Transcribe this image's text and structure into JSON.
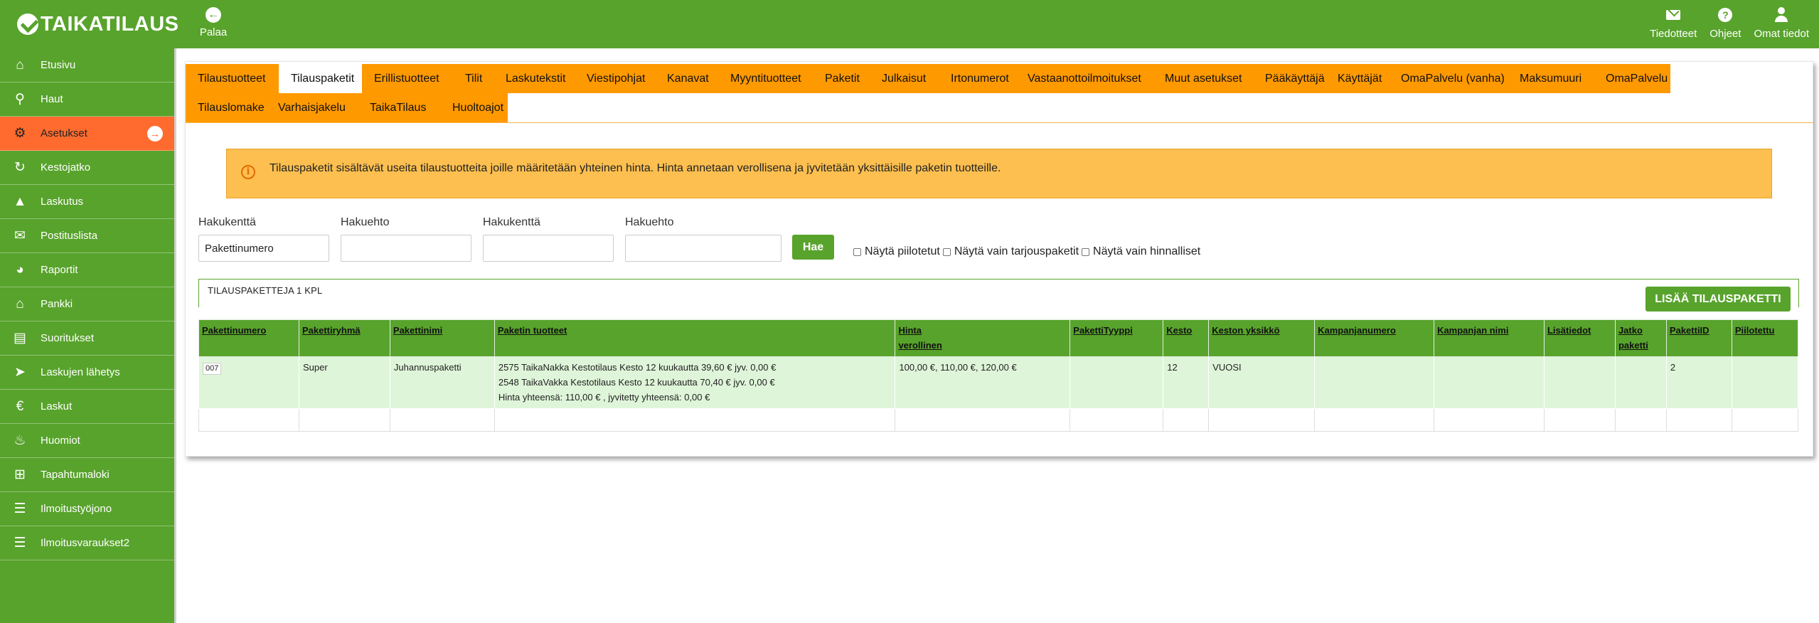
{
  "app": {
    "logo_text": "TAIKATILAUS",
    "back_label": "Palaa"
  },
  "header_actions": [
    {
      "label": "Tiedotteet",
      "icon": "envelope-icon"
    },
    {
      "label": "Ohjeet",
      "icon": "help-icon"
    },
    {
      "label": "Omat tiedot",
      "icon": "user-icon"
    }
  ],
  "sidebar": {
    "items": [
      {
        "label": "Etusivu",
        "icon": "home-icon"
      },
      {
        "label": "Haut",
        "icon": "search-icon"
      },
      {
        "label": "Asetukset",
        "icon": "gear-icon",
        "active": true
      },
      {
        "label": "Kestojatko",
        "icon": "refresh-icon"
      },
      {
        "label": "Laskutus",
        "icon": "thumbs-up-icon"
      },
      {
        "label": "Postituslista",
        "icon": "envelope-icon"
      },
      {
        "label": "Raportit",
        "icon": "pie-chart-icon"
      },
      {
        "label": "Pankki",
        "icon": "bank-icon"
      },
      {
        "label": "Suoritukset",
        "icon": "receipt-icon"
      },
      {
        "label": "Laskujen lähetys",
        "icon": "send-icon"
      },
      {
        "label": "Laskut",
        "icon": "euro-icon"
      },
      {
        "label": "Huomiot",
        "icon": "bell-icon"
      },
      {
        "label": "Tapahtumaloki",
        "icon": "grid-icon"
      },
      {
        "label": "Ilmoitustyöjono",
        "icon": "list-icon"
      },
      {
        "label": "Ilmoitusvaraukset2",
        "icon": "list-indent-icon"
      }
    ]
  },
  "tabs": {
    "row1": [
      "Tilaustuotteet",
      "Tilauspaketit",
      "Erillistuotteet",
      "Tilit",
      "Laskutekstit",
      "Viestipohjat",
      "Kanavat",
      "Myyntituotteet",
      "Paketit",
      "Julkaisut",
      "Irtonumerot",
      "Vastaanottoilmoitukset",
      "Muut asetukset",
      "Pääkäyttäjä",
      "Käyttäjät",
      "OmaPalvelu (vanha)",
      "Maksumuuri",
      "OmaPalvelu"
    ],
    "row2": [
      "Tilauslomake",
      "Varhaisjakelu",
      "TaikaTilaus",
      "Huoltoajot"
    ],
    "active": "Tilauspaketit"
  },
  "info_message": "Tilauspaketit sisältävät useita tilaustuotteita joille määritetään yhteinen hinta. Hinta annetaan verollisena ja jyvitetään yksittäisille paketin tuotteille.",
  "search": {
    "fields": [
      {
        "label": "Hakukenttä",
        "value": "Pakettinumero"
      },
      {
        "label": "Hakuehto",
        "value": ""
      },
      {
        "label": "Hakukenttä",
        "value": ""
      },
      {
        "label": "Hakuehto",
        "value": ""
      }
    ],
    "button_label": "Hae",
    "checkboxes": [
      "Näytä piilotetut",
      "Näytä vain tarjouspaketit",
      "Näytä vain hinnalliset"
    ]
  },
  "results": {
    "count_label": "TILAUSPAKETTEJA 1 KPL",
    "add_button_label": "LISÄÄ TILAUSPAKETTI",
    "columns": [
      "Pakettinumero",
      "Pakettiryhmä",
      "Pakettinimi",
      "Paketin tuotteet",
      "Hinta verollinen",
      "PakettiTyyppi",
      "Kesto",
      "Keston yksikkö",
      "Kampanjanumero",
      "Kampanjan nimi",
      "Lisätiedot",
      "Jatko paketti",
      "PakettiID",
      "Piilotettu"
    ],
    "rows": [
      {
        "pakettinumero": "007",
        "pakettiryhma": "Super",
        "pakettinimi": "Juhannuspaketti",
        "tuotteet": [
          "2575 TaikaNakka Kestotilaus Kesto 12 kuukautta 39,60 € jyv. 0,00 €",
          "2548 TaikaVakka Kestotilaus Kesto 12 kuukautta 70,40 € jyv. 0,00 €",
          "Hinta yhteensä: 110,00 € , jyvitetty yhteensä: 0,00 €"
        ],
        "hinta": "100,00 €, 110,00 €, 120,00 €",
        "pakettityyppi": "",
        "kesto": "12",
        "keston_yksikko": "VUOSI",
        "kampanjanumero": "",
        "kampanjan_nimi": "",
        "lisatiedot": "",
        "jatko_paketti": "",
        "paketti_id": "2",
        "piilotettu": ""
      }
    ]
  },
  "colors": {
    "green": "#58a32c",
    "orange": "#ff9900",
    "active_nav": "#ff6b2e",
    "info_bg": "#fdbf4f",
    "row_bg": "#dff5d9"
  }
}
